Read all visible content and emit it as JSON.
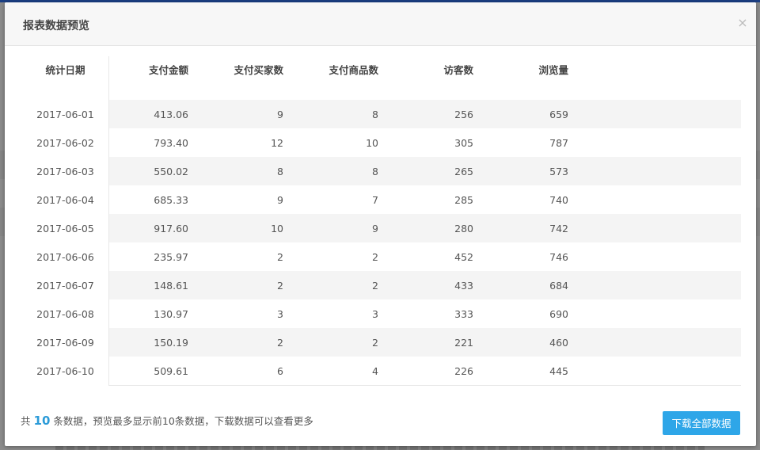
{
  "modal": {
    "title": "报表数据预览",
    "close_glyph": "×"
  },
  "table": {
    "headers": [
      "统计日期",
      "支付金额",
      "支付买家数",
      "支付商品数",
      "访客数",
      "浏览量"
    ],
    "rows": [
      [
        "2017-06-01",
        "413.06",
        "9",
        "8",
        "256",
        "659"
      ],
      [
        "2017-06-02",
        "793.40",
        "12",
        "10",
        "305",
        "787"
      ],
      [
        "2017-06-03",
        "550.02",
        "8",
        "8",
        "265",
        "573"
      ],
      [
        "2017-06-04",
        "685.33",
        "9",
        "7",
        "285",
        "740"
      ],
      [
        "2017-06-05",
        "917.60",
        "10",
        "9",
        "280",
        "742"
      ],
      [
        "2017-06-06",
        "235.97",
        "2",
        "2",
        "452",
        "746"
      ],
      [
        "2017-06-07",
        "148.61",
        "2",
        "2",
        "433",
        "684"
      ],
      [
        "2017-06-08",
        "130.97",
        "3",
        "3",
        "333",
        "690"
      ],
      [
        "2017-06-09",
        "150.19",
        "2",
        "2",
        "221",
        "460"
      ],
      [
        "2017-06-10",
        "509.61",
        "6",
        "4",
        "226",
        "445"
      ]
    ]
  },
  "footer": {
    "prefix": "共",
    "count": "10",
    "suffix": "条数据，预览最多显示前10条数据，下载数据可以查看更多",
    "download_label": "下载全部数据"
  },
  "colors": {
    "accent": "#2ea6e8",
    "count_highlight": "#2b9bd8"
  }
}
